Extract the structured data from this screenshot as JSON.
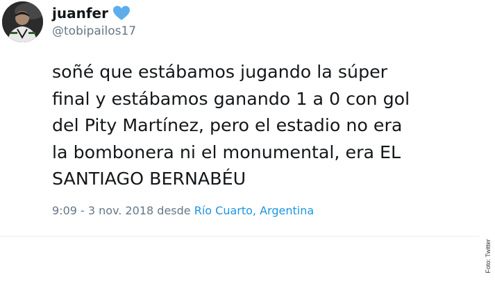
{
  "tweet": {
    "display_name": "juanfer",
    "handle": "@tobipailos17",
    "avatar_icon": "user-avatar",
    "name_emoji_icon": "blue-heart-icon",
    "text_lines": [
      "soñé que estábamos jugando la súper",
      "final y estábamos ganando 1 a 0 con gol",
      "del Pity Martínez, pero el estadio no era",
      "la bombonera ni el monumental, era EL",
      "SANTIAGO BERNABÉU"
    ],
    "timestamp": "9:09 - 3 nov. 2018",
    "location_prefix": "desde",
    "location": "Río Cuarto, Argentina"
  },
  "credit": "Foto: Twitter",
  "colors": {
    "text": "#14171a",
    "secondary": "#657786",
    "link": "#1b95e0",
    "heart": "#5dadec"
  }
}
